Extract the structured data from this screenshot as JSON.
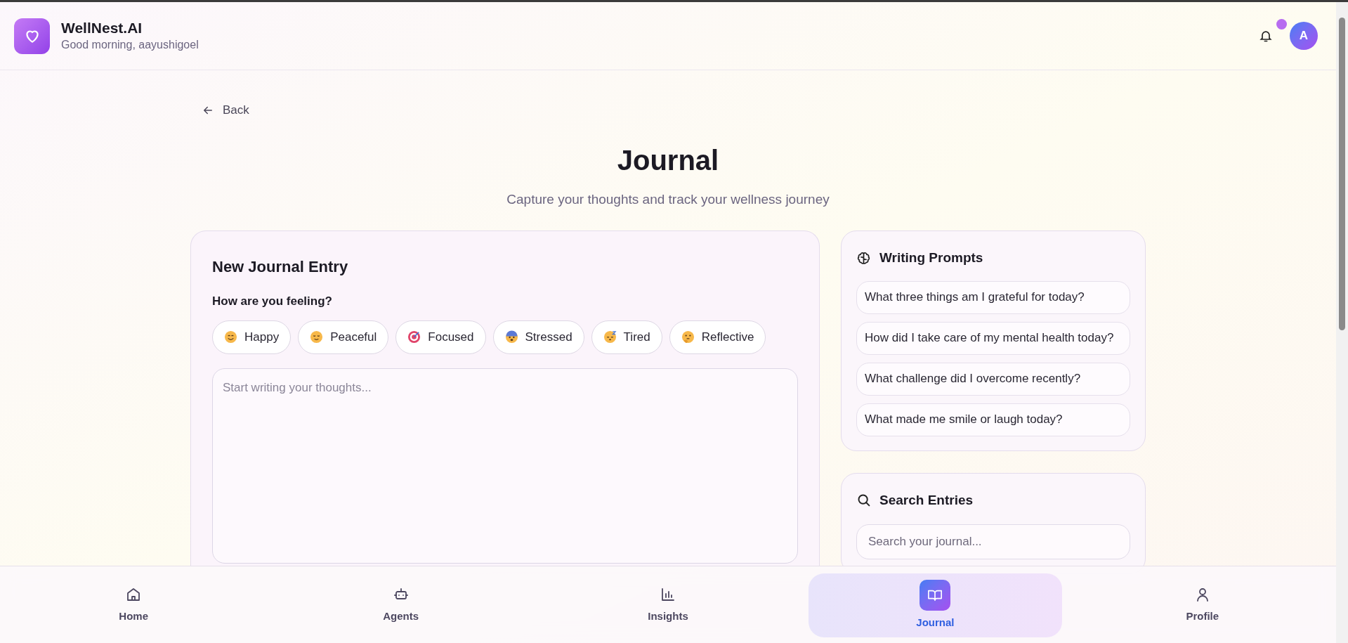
{
  "app": {
    "name": "WellNest.AI",
    "greeting": "Good morning, aayushigoel",
    "avatar_initial": "A",
    "has_notification": true
  },
  "back": {
    "label": "Back"
  },
  "page": {
    "title": "Journal",
    "subtitle": "Capture your thoughts and track your wellness journey"
  },
  "entry": {
    "title": "New Journal Entry",
    "mood_question": "How are you feeling?",
    "moods": [
      {
        "label": "Happy",
        "kind": "smile",
        "selected": false
      },
      {
        "label": "Peaceful",
        "kind": "calm",
        "selected": false
      },
      {
        "label": "Focused",
        "kind": "target",
        "selected": false
      },
      {
        "label": "Stressed",
        "kind": "fear",
        "selected": false
      },
      {
        "label": "Tired",
        "kind": "sleepy",
        "selected": false
      },
      {
        "label": "Reflective",
        "kind": "thinking",
        "selected": false
      }
    ],
    "placeholder": "Start writing your thoughts..."
  },
  "prompts": {
    "title": "Writing Prompts",
    "items": [
      "What three things am I grateful for today?",
      "How did I take care of my mental health today?",
      "What challenge did I overcome recently?",
      "What made me smile or laugh today?"
    ]
  },
  "search": {
    "title": "Search Entries",
    "placeholder": "Search your journal..."
  },
  "nav": [
    {
      "label": "Home",
      "kind": "home",
      "selected": false
    },
    {
      "label": "Agents",
      "kind": "bot",
      "selected": false
    },
    {
      "label": "Insights",
      "kind": "chart",
      "selected": false
    },
    {
      "label": "Journal",
      "kind": "book",
      "selected": true
    },
    {
      "label": "Profile",
      "kind": "user",
      "selected": false
    }
  ]
}
